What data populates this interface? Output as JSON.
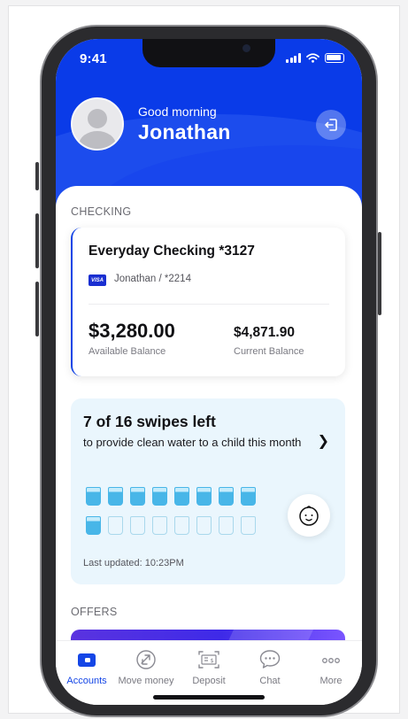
{
  "status_bar": {
    "time": "9:41"
  },
  "header": {
    "greeting": "Good morning",
    "user_name": "Jonathan"
  },
  "checking": {
    "section_label": "CHECKING",
    "account_name": "Everyday Checking *3127",
    "card_brand": "VISA",
    "card_owner": "Jonathan / *2214",
    "available_balance": "$3,280.00",
    "available_label": "Available Balance",
    "current_balance": "$4,871.90",
    "current_label": "Current Balance"
  },
  "impact": {
    "title": "7 of 16 swipes left",
    "subtitle": "to provide clean water to a child this month",
    "glasses_total": 16,
    "glasses_filled": 9,
    "last_updated": "Last updated: 10:23PM"
  },
  "offers": {
    "section_label": "OFFERS"
  },
  "tabbar": {
    "items": [
      {
        "label": "Accounts",
        "icon": "accounts-icon",
        "active": true
      },
      {
        "label": "Move money",
        "icon": "move-money-icon",
        "active": false
      },
      {
        "label": "Deposit",
        "icon": "deposit-icon",
        "active": false
      },
      {
        "label": "Chat",
        "icon": "chat-icon",
        "active": false
      },
      {
        "label": "More",
        "icon": "more-icon",
        "active": false
      }
    ]
  },
  "colors": {
    "brand_blue": "#0a3be8",
    "accent_blue": "#1546e6",
    "water_blue": "#48b6e8",
    "impact_bg": "#eaf6fd"
  }
}
